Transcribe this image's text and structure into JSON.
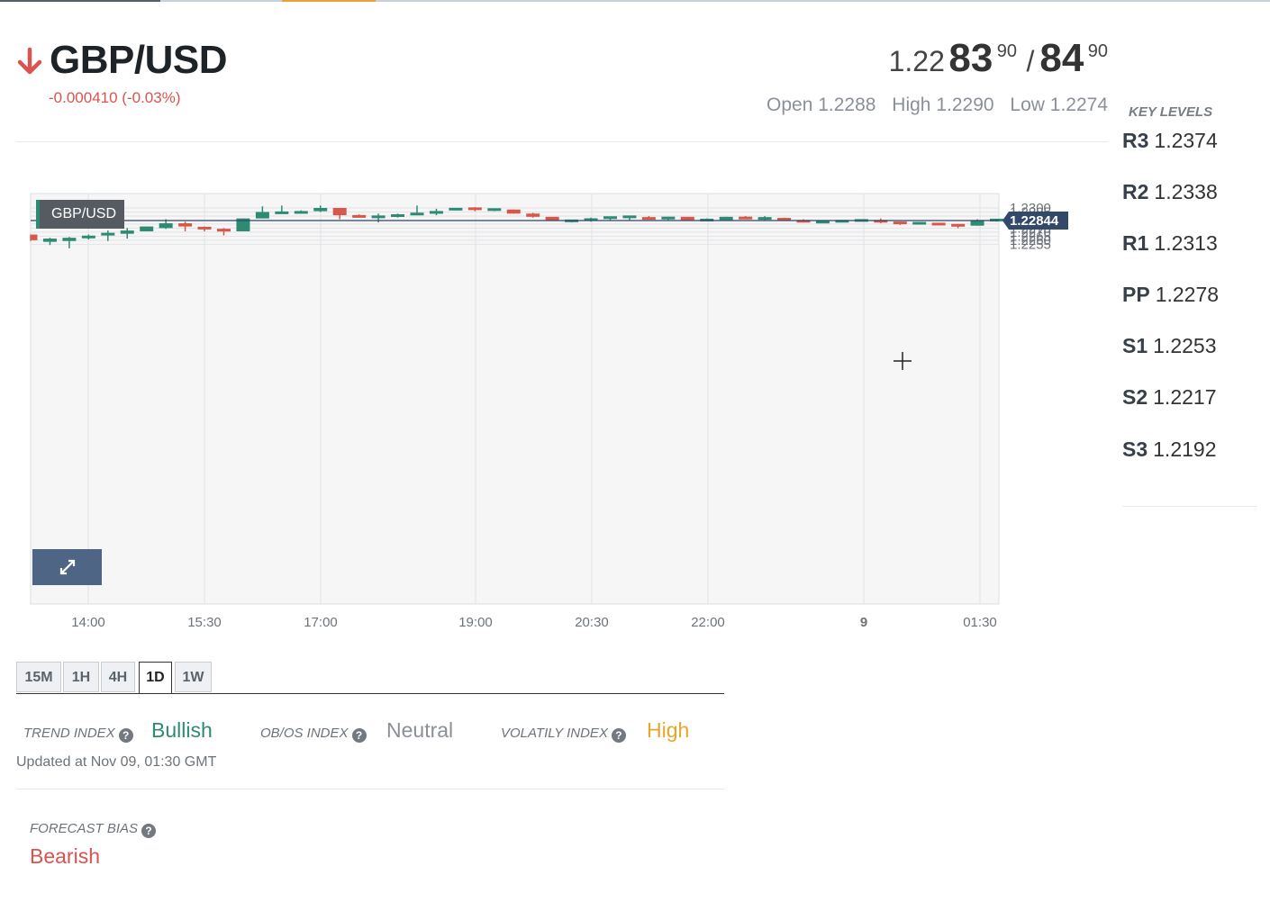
{
  "instrument": {
    "pair": "GBP/USD",
    "direction_icon": "arrow-down-icon",
    "change": "-0.000410 (-0.03%)"
  },
  "quote": {
    "bid_prefix": "1.22",
    "bid_big": "83",
    "bid_pip": "90",
    "separator": "/",
    "ask_big": "84",
    "ask_pip": "90",
    "open": "Open 1.2288",
    "high": "High 1.2290",
    "low": "Low 1.2274"
  },
  "key_levels": {
    "title": "KEY LEVELS",
    "levels": [
      {
        "name": "R3",
        "value": "1.2374"
      },
      {
        "name": "R2",
        "value": "1.2338"
      },
      {
        "name": "R1",
        "value": "1.2313"
      },
      {
        "name": "PP",
        "value": "1.2278"
      },
      {
        "name": "S1",
        "value": "1.2253"
      },
      {
        "name": "S2",
        "value": "1.2217"
      },
      {
        "name": "S3",
        "value": "1.2192"
      }
    ]
  },
  "chart_data": {
    "type": "candlestick",
    "title": "GBP/USD",
    "current_price": 1.22844,
    "current_price_label": "1.22844",
    "ylim": [
      1.2249,
      1.2309
    ],
    "y_ticks": [
      "1.2300",
      "1.2295",
      "1.2290",
      "1.2285",
      "1.2280",
      "1.2275",
      "1.2270",
      "1.2265",
      "1.2260",
      "1.2255"
    ],
    "x_ticks": [
      "14:00",
      "15:30",
      "17:00",
      "19:00",
      "20:30",
      "22:00",
      "9",
      "01:30"
    ],
    "grid": true,
    "up_color": "#2e8b73",
    "down_color": "#d9574a",
    "candles": [
      [
        1.2267,
        1.226,
        1.2267,
        1.2259
      ],
      [
        1.2258,
        1.2262,
        1.2263,
        1.2254
      ],
      [
        1.2259,
        1.2263,
        1.2264,
        1.225
      ],
      [
        1.2263,
        1.2265,
        1.2267,
        1.2261
      ],
      [
        1.2266,
        1.2269,
        1.2272,
        1.2259
      ],
      [
        1.2268,
        1.2272,
        1.2275,
        1.2262
      ],
      [
        1.2271,
        1.2277,
        1.2277,
        1.2271
      ],
      [
        1.2275,
        1.2281,
        1.2286,
        1.2274
      ],
      [
        1.2281,
        1.2277,
        1.2283,
        1.2271
      ],
      [
        1.2276,
        1.2274,
        1.2277,
        1.2271
      ],
      [
        1.2274,
        1.2271,
        1.2275,
        1.2266
      ],
      [
        1.2271,
        1.2287,
        1.2287,
        1.2271
      ],
      [
        1.2287,
        1.2295,
        1.2302,
        1.2287
      ],
      [
        1.2294,
        1.2294,
        1.2303,
        1.2294
      ],
      [
        1.2294,
        1.2295,
        1.2297,
        1.2293
      ],
      [
        1.2296,
        1.23,
        1.2303,
        1.2295
      ],
      [
        1.23,
        1.2291,
        1.23,
        1.2286
      ],
      [
        1.229,
        1.2289,
        1.2292,
        1.2288
      ],
      [
        1.2289,
        1.2289,
        1.2293,
        1.2282
      ],
      [
        1.2289,
        1.2292,
        1.2293,
        1.2288
      ],
      [
        1.2292,
        1.2293,
        1.2303,
        1.2291
      ],
      [
        1.2293,
        1.2296,
        1.2299,
        1.2291
      ],
      [
        1.2297,
        1.23,
        1.23,
        1.2297
      ],
      [
        1.23,
        1.2298,
        1.2301,
        1.2296
      ],
      [
        1.2298,
        1.2298,
        1.2299,
        1.2296
      ],
      [
        1.2298,
        1.2293,
        1.2298,
        1.2293
      ],
      [
        1.2293,
        1.2289,
        1.2294,
        1.2288
      ],
      [
        1.2289,
        1.2284,
        1.2289,
        1.2284
      ],
      [
        1.2284,
        1.2284,
        1.2285,
        1.2282
      ],
      [
        1.2284,
        1.2287,
        1.2288,
        1.2283
      ],
      [
        1.2287,
        1.2289,
        1.2289,
        1.2284
      ],
      [
        1.2289,
        1.2289,
        1.229,
        1.2285
      ],
      [
        1.2288,
        1.2286,
        1.229,
        1.2286
      ],
      [
        1.2286,
        1.2289,
        1.2289,
        1.2285
      ],
      [
        1.2289,
        1.2285,
        1.2289,
        1.2285
      ],
      [
        1.2285,
        1.2285,
        1.2287,
        1.2284
      ],
      [
        1.2285,
        1.2289,
        1.2289,
        1.2285
      ],
      [
        1.2288,
        1.2287,
        1.229,
        1.2286
      ],
      [
        1.2287,
        1.2287,
        1.229,
        1.2284
      ],
      [
        1.2287,
        1.2285,
        1.2288,
        1.2284
      ],
      [
        1.2285,
        1.2282,
        1.2286,
        1.2282
      ],
      [
        1.2282,
        1.2283,
        1.2284,
        1.2281
      ],
      [
        1.2283,
        1.2284,
        1.2285,
        1.2283
      ],
      [
        1.2284,
        1.2285,
        1.2285,
        1.2284
      ],
      [
        1.2285,
        1.2282,
        1.2287,
        1.2281
      ],
      [
        1.2282,
        1.2281,
        1.2283,
        1.2279
      ],
      [
        1.2281,
        1.2281,
        1.2282,
        1.228
      ],
      [
        1.2281,
        1.2279,
        1.2281,
        1.2279
      ],
      [
        1.2279,
        1.2278,
        1.228,
        1.2275
      ],
      [
        1.2278,
        1.2285,
        1.2286,
        1.2278
      ],
      [
        1.2285,
        1.2285,
        1.2286,
        1.2283
      ]
    ]
  },
  "chart_ui": {
    "expand_icon": "expand-icon"
  },
  "timeframes": {
    "tabs": [
      "15M",
      "1H",
      "4H",
      "1D",
      "1W"
    ],
    "active": "1D"
  },
  "indices": {
    "trend_label": "TREND INDEX",
    "trend_value": "Bullish",
    "obos_label": "OB/OS INDEX",
    "obos_value": "Neutral",
    "volatility_label": "VOLATILY INDEX",
    "volatility_value": "High",
    "help_icon": "question-circle-icon",
    "colors": {
      "bullish": "#2e8b73",
      "neutral": "#8a9098",
      "high": "#e8a628",
      "bearish": "#d9534f"
    }
  },
  "updated": "Updated at Nov 09, 01:30 GMT",
  "forecast": {
    "label": "FORECAST BIAS",
    "value": "Bearish"
  }
}
